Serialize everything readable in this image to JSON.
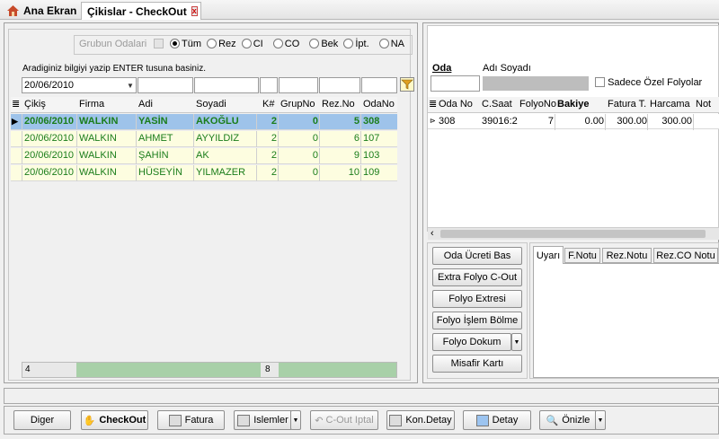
{
  "tabs": {
    "home": "Ana Ekran",
    "checkout": "Çikislar - CheckOut",
    "close": "x"
  },
  "filter": {
    "group_label": "Grubun Odalari",
    "radios": [
      {
        "label": "Tüm",
        "selected": true
      },
      {
        "label": "Rez",
        "selected": false
      },
      {
        "label": "CI",
        "selected": false
      },
      {
        "label": "CO",
        "selected": false
      },
      {
        "label": "Bek",
        "selected": false
      },
      {
        "label": "İpt.",
        "selected": false
      },
      {
        "label": "NA",
        "selected": false
      }
    ],
    "hint": "Aradiginiz bilgiyi yazip ENTER tusuna basiniz.",
    "date_value": "20/06/2010"
  },
  "grid": {
    "columns": [
      "Çikiş",
      "Firma",
      "Adi",
      "Soyadi",
      "K#",
      "GrupNo",
      "Rez.No",
      "OdaNo"
    ],
    "rows": [
      {
        "cikis": "20/06/2010",
        "firma": "WALKIN",
        "adi": "YASİN",
        "soyadi": "AKOĞLU",
        "k": "2",
        "grupno": "0",
        "rezno": "5",
        "odano": "308",
        "selected": true
      },
      {
        "cikis": "20/06/2010",
        "firma": "WALKIN",
        "adi": "AHMET",
        "soyadi": "AYYILDIZ",
        "k": "2",
        "grupno": "0",
        "rezno": "6",
        "odano": "107"
      },
      {
        "cikis": "20/06/2010",
        "firma": "WALKIN",
        "adi": "ŞAHİN",
        "soyadi": "AK",
        "k": "2",
        "grupno": "0",
        "rezno": "9",
        "odano": "103"
      },
      {
        "cikis": "20/06/2010",
        "firma": "WALKIN",
        "adi": "HÜSEYİN",
        "soyadi": "YILMAZER",
        "k": "2",
        "grupno": "0",
        "rezno": "10",
        "odano": "109"
      }
    ],
    "footer_count": "4",
    "footer_k": "8"
  },
  "right": {
    "oda_label": "Oda",
    "adi_soyadi_label": "Adı Soyadı",
    "ozel_label": "Sadece Özel Folyolar",
    "folyo_columns": [
      "Oda No",
      "C.Saat",
      "FolyoNo",
      "Bakiye",
      "Fatura T.",
      "Harcama",
      "Not"
    ],
    "folyo_row": {
      "oda": "308",
      "csaat": "39016:2",
      "folyo": "7",
      "bakiye": "0.00",
      "fatura": "300.00",
      "harcama": "300.00"
    },
    "buttons": [
      "Oda Ücreti Bas",
      "Extra Folyo C-Out",
      "Folyo Extresi",
      "Folyo İşlem Bölme",
      "Folyo Dokum",
      "Misafir Kartı"
    ],
    "note_tabs": [
      "Uyarı",
      "F.Notu",
      "Rez.Notu",
      "Rez.CO Notu"
    ]
  },
  "bottom": {
    "buttons": [
      "Diger",
      "CheckOut",
      "Fatura",
      "Islemler",
      "C-Out Iptal",
      "Kon.Detay",
      "Detay",
      "Önizle"
    ]
  },
  "colors": {
    "selected_row": "#9ec3ea",
    "alt_row": "#fdfde0",
    "green_text": "#1a7d1a",
    "footer_green": "#a8d0a8"
  }
}
